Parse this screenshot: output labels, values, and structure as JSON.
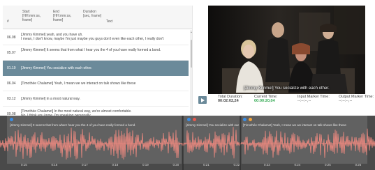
{
  "table": {
    "headers": {
      "id": "#",
      "start": "Start [HH:mm:ss, frame]",
      "end": "End [HH:mm:ss, frame]",
      "duration": "Duration [sec, frame]",
      "text": "Text"
    },
    "rows": [
      {
        "id": "06.08",
        "text": "[Jimmy Kimmel] yeah, and you have uh.\nI mean, I don't know, maybe I'm just maybe you guys don't even like each other, I really don't",
        "selected": false
      },
      {
        "id": "05.07",
        "text": "[Jimmy Kimmel] It seems that from what I hear you the 4 of you have really formed a bond.",
        "selected": false
      },
      {
        "id": "01.19",
        "text": "[Jimmy Kimmel] You socialize with each other.",
        "selected": true
      },
      {
        "id": "06.04",
        "text": "[Timothée Chalamet] Yeah, I mean we we interact on talk shows like these",
        "selected": false
      },
      {
        "id": "03.12",
        "text": "[Jimmy Kimmel] in a most natural way.",
        "selected": false
      },
      {
        "id": "09.08",
        "text": "[Timothée Chalamet] In the most natural way, we're almost comfortable.\nNo. I think you know. I'm speaking personally.",
        "selected": false
      }
    ]
  },
  "video": {
    "subtitle": "[Jimmy Kimmel] You socialize with each other."
  },
  "player": {
    "total_label": "Total Duration:",
    "total_value": "00:02:02,24",
    "current_label": "Current Time:",
    "current_value": "00:00:20,04",
    "input_label": "Input Marker Time:",
    "input_value": "--:--:--,--",
    "output_label": "Output Marker Time:",
    "output_value": "--:--:--,--"
  },
  "waveform": {
    "regions": [
      "[Jimmy Kimmel] It seems that from what I hear you the 4 of you have really formed a bond.",
      "[Jimmy Kimmel] You socialize with each other.",
      "[Timothée Chalamet] Yeah, I mean we we interact on talk shows like these"
    ],
    "ticks": [
      "0:15",
      "0:16",
      "0:17",
      "0:18",
      "0:19",
      "0:20",
      "0:21",
      "0:22",
      "0:23",
      "0:24",
      "0:25",
      "0:26"
    ],
    "wave_color": "#f08a80",
    "background_color": "#4a4a4a"
  },
  "colors": {
    "selected_row": "#6b8a9a",
    "current_time": "#2fa84f"
  }
}
